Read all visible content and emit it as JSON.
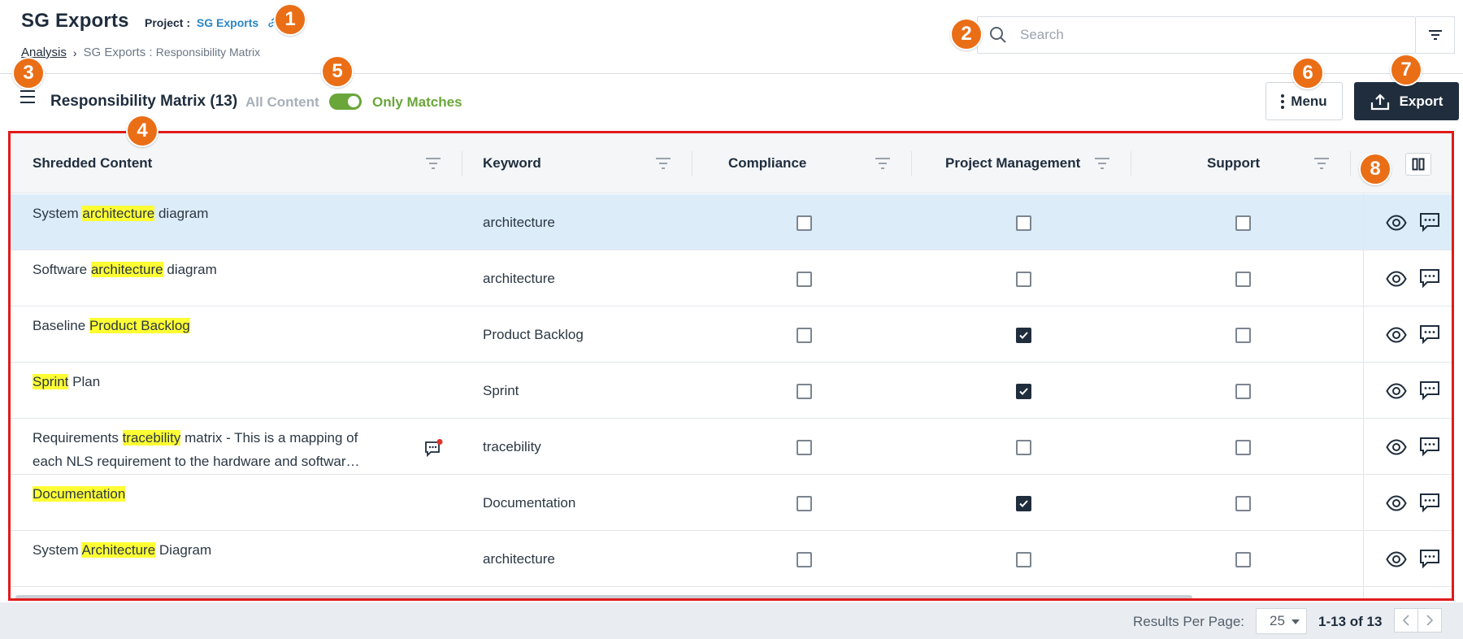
{
  "header": {
    "app_title": "SG Exports",
    "project_label": "Project :",
    "project_link": "SG Exports",
    "breadcrumb": {
      "root": "Analysis",
      "current_prefix": "SG Exports :",
      "current": "Responsibility Matrix"
    },
    "search": {
      "placeholder": "Search",
      "value": ""
    }
  },
  "toolbar": {
    "matrix_title": "Responsibility Matrix (13)",
    "all_content_label": "All Content",
    "only_matches_label": "Only Matches",
    "toggle_on": true,
    "menu_label": "Menu",
    "export_label": "Export"
  },
  "table": {
    "columns": {
      "shredded_content": "Shredded Content",
      "keyword": "Keyword",
      "compliance": "Compliance",
      "project_management": "Project Management",
      "support": "Support"
    },
    "rows": [
      {
        "before": "System ",
        "match": "architecture",
        "after": " diagram",
        "keyword": "architecture",
        "compliance": false,
        "project_management": false,
        "support": false,
        "selected": true
      },
      {
        "before": "Software ",
        "match": "architecture",
        "after": " diagram",
        "keyword": "architecture",
        "compliance": false,
        "project_management": false,
        "support": false,
        "selected": false
      },
      {
        "before": "Baseline ",
        "match": "Product Backlog",
        "after": "",
        "keyword": "Product Backlog",
        "compliance": false,
        "project_management": true,
        "support": false,
        "selected": false
      },
      {
        "before": "",
        "match": "Sprint",
        "after": " Plan",
        "keyword": "Sprint",
        "compliance": false,
        "project_management": true,
        "support": false,
        "selected": false
      },
      {
        "before": "Requirements ",
        "match": "tracebility",
        "after": " matrix - This is a mapping of each NLS requirement to the hardware and softwar…",
        "keyword": "tracebility",
        "compliance": false,
        "project_management": false,
        "support": false,
        "selected": false,
        "has_note": true
      },
      {
        "before": "",
        "match": "Documentation",
        "after": "",
        "keyword": "Documentation",
        "compliance": false,
        "project_management": true,
        "support": false,
        "selected": false
      },
      {
        "before": "System ",
        "match": "Architecture",
        "after": " Diagram",
        "keyword": "architecture",
        "compliance": false,
        "project_management": false,
        "support": false,
        "selected": false
      }
    ]
  },
  "footer": {
    "results_per_page_label": "Results Per Page:",
    "results_per_page_value": "25",
    "range": "1-13 of 13"
  },
  "badges": [
    "1",
    "2",
    "3",
    "4",
    "5",
    "6",
    "7",
    "8"
  ],
  "colors": {
    "accent_orange": "#ea6e16",
    "highlight_yellow": "#ffff33",
    "toggle_green": "#6aa63a",
    "export_dark": "#1f2d3d",
    "table_outline_red": "#e01b1b",
    "link_blue": "#2a86c8",
    "selected_row": "#dcecf9"
  },
  "icons": {
    "link": "link-icon",
    "search": "search-icon",
    "filter": "filter-icon",
    "hamburger": "hamburger-icon",
    "menu": "more-vertical-icon",
    "export": "upload-icon",
    "column_toggle": "columns-icon",
    "view": "eye-icon",
    "comment": "comment-icon",
    "note": "note-icon"
  }
}
